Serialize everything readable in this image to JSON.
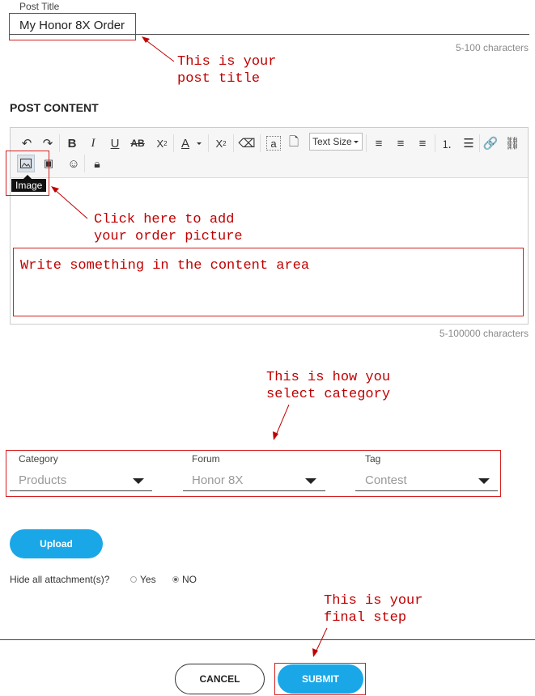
{
  "post_title": {
    "label": "Post Title",
    "value": "My Honor 8X Order",
    "limit": "5-100 characters"
  },
  "post_content": {
    "heading": "POST CONTENT",
    "limit": "5-100000 characters",
    "text_size_label": "Text Size",
    "image_tooltip": "Image"
  },
  "annotations": {
    "title_note_1": "This is your",
    "title_note_2": "post title",
    "image_note_1": "Click here to add",
    "image_note_2": "your order picture",
    "content_note": "Write something in the content area",
    "category_note_1": "This is how you",
    "category_note_2": "select category",
    "submit_note_1": "This is your",
    "submit_note_2": "final step"
  },
  "selectors": {
    "category": {
      "label": "Category",
      "value": "Products"
    },
    "forum": {
      "label": "Forum",
      "value": "Honor 8X"
    },
    "tag": {
      "label": "Tag",
      "value": "Contest"
    }
  },
  "upload": {
    "label": "Upload"
  },
  "attachments": {
    "question": "Hide all attachment(s)?",
    "yes": "Yes",
    "no": "NO",
    "selected": "NO"
  },
  "actions": {
    "cancel": "CANCEL",
    "submit": "SUBMIT"
  },
  "colors": {
    "accent": "#1aa7e8",
    "annotation": "#c00000"
  }
}
